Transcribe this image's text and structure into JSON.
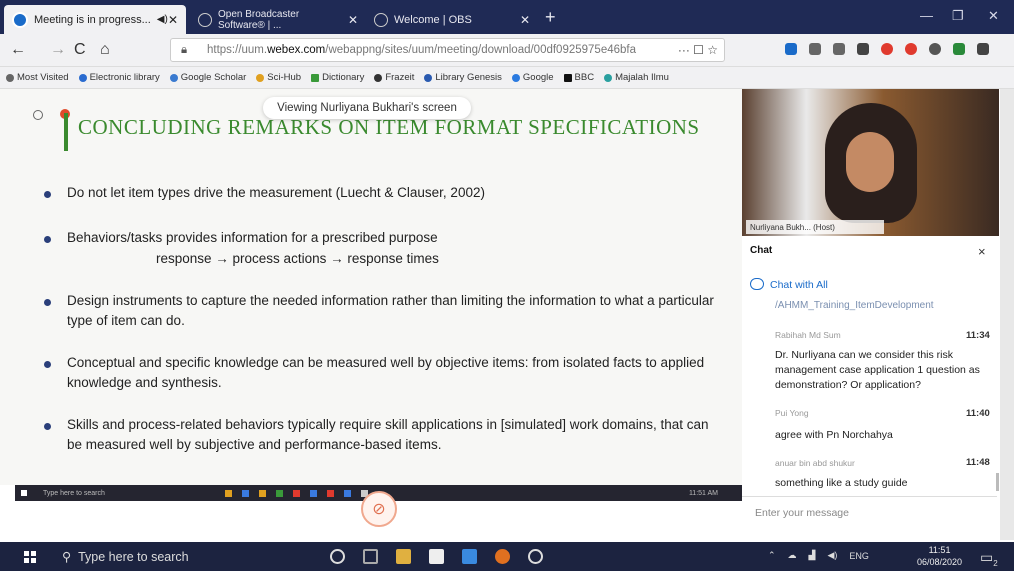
{
  "browser": {
    "tabs": [
      {
        "label": "Meeting is in progress...",
        "audio": "◀)",
        "close": "✕"
      },
      {
        "label": "Open Broadcaster Software® | ...",
        "close": "✕"
      },
      {
        "label": "Welcome | OBS",
        "close": "✕"
      }
    ],
    "new_tab": "+",
    "url_prefix": "https://uum.",
    "url_domain": "webex.com",
    "url_rest": "/webappng/sites/uum/meeting/download/00df0925975e46bfa",
    "url_actions": "··· ☐ ☆",
    "bookmarks": [
      "Most Visited",
      "Electronic library",
      "Google Scholar",
      "Sci-Hub",
      "Dictionary",
      "Frazeit",
      "Library Genesis",
      "Google",
      "BBC",
      "Majalah Ilmu"
    ]
  },
  "slide": {
    "banner": "Viewing Nurliyana Bukhari's screen",
    "title": "CONCLUDING REMARKS ON ITEM FORMAT SPECIFICATIONS",
    "bullets": [
      "Do not let item types drive the measurement (Luecht & Clauser, 2002)",
      "Behaviors/tasks provides information for a prescribed purpose",
      "Design instruments to capture the needed information rather than limiting the information to what a particular type of item can do.",
      "Conceptual and specific knowledge can be measured well by objective items: from isolated facts to applied knowledge and synthesis.",
      "Skills and process-related behaviors typically require skill applications in [simulated] work domains, that can be measured well by subjective and performance-based items."
    ],
    "sub_line": "response → process actions → response times",
    "inner_search": "Type here to search",
    "inner_clock": "11:51 AM"
  },
  "video": {
    "label": "Nurliyana Bukh... (Host)"
  },
  "chat": {
    "title": "Chat",
    "close": "×",
    "chat_with": "Chat with All",
    "prev_line": "/AHMM_Training_ItemDevelopment",
    "messages": [
      {
        "sender": "Rabihah Md Sum",
        "time": "11:34",
        "text": "Dr. Nurliyana can we consider this risk management case application 1 question as demonstration? Or application?"
      },
      {
        "sender": "Pui Yong",
        "time": "11:40",
        "text": "agree with Pn Norchahya"
      },
      {
        "sender": "anuar bin abd shukur",
        "time": "11:48",
        "text": "something like a study guide"
      }
    ],
    "input_placeholder": "Enter your message"
  },
  "taskbar": {
    "search": "Type here to search",
    "tray_lang": "ENG",
    "time": "11:51",
    "date": "06/08/2020",
    "notif_count": "2"
  },
  "colors": {
    "title_green": "#3a8a2e",
    "bullet_navy": "#2a3f7a",
    "chat_blue": "#1a6bc9",
    "taskbar": "#1c2340"
  }
}
